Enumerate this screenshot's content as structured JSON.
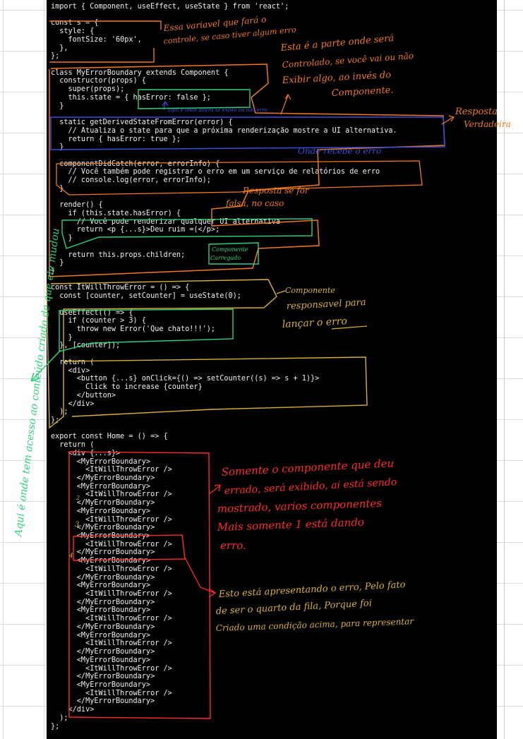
{
  "code_lines": [
    "import { Component, useEffect, useState } from 'react';",
    "",
    "const s = {",
    "  style: {",
    "    fontSize: '60px',",
    "  },",
    "};",
    "",
    "class MyErrorBoundary extends Component {",
    "  constructor(props) {",
    "    super(props);",
    "    this.state = { hasError: false };",
    "  }",
    "",
    "  static getDerivedStateFromError(error) {",
    "    // Atualiza o state para que a próxima renderização mostre a UI alternativa.",
    "    return { hasError: true };",
    "  }",
    "",
    "  componentDidCatch(error, errorInfo) {",
    "    // Você também pode registrar o erro em um serviço de relatórios de erro",
    "    // console.log(error, errorInfo);",
    "  }",
    "",
    "  render() {",
    "    if (this.state.hasError) {",
    "      // Você pode renderizar qualquer UI alternativa",
    "      return <p {...s}>Deu ruim =(</p>;",
    "    }",
    "",
    "    return this.props.children;",
    "  }",
    "}",
    "",
    "const ItWillThrowError = () => {",
    "  const [counter, setCounter] = useState(0);",
    "",
    "  useEffect(() => {",
    "    if (counter > 3) {",
    "      throw new Error('Que chato!!!');",
    "    }",
    "  }, [counter]);",
    "",
    "  return (",
    "    <div>",
    "      <button {...s} onClick={() => setCounter((s) => s + 1)}>",
    "        Click to increase {counter}",
    "      </button>",
    "    </div>",
    "  );",
    "};",
    "",
    "export const Home = () => {",
    "  return (",
    "    <div {...s}>",
    "      <MyErrorBoundary>",
    "        <ItWillThrowError />",
    "      </MyErrorBoundary>",
    "      <MyErrorBoundary>",
    "        <ItWillThrowError />",
    "      </MyErrorBoundary>",
    "      <MyErrorBoundary>",
    "        <ItWillThrowError />",
    "      </MyErrorBoundary>",
    "      <MyErrorBoundary>",
    "        <ItWillThrowError />",
    "      </MyErrorBoundary>",
    "      <MyErrorBoundary>",
    "        <ItWillThrowError />",
    "      </MyErrorBoundary>",
    "      <MyErrorBoundary>",
    "        <ItWillThrowError />",
    "      </MyErrorBoundary>",
    "      <MyErrorBoundary>",
    "        <ItWillThrowError />",
    "      </MyErrorBoundary>",
    "      <MyErrorBoundary>",
    "        <ItWillThrowError />",
    "      </MyErrorBoundary>",
    "      <MyErrorBoundary>",
    "        <ItWillThrowError />",
    "      </MyErrorBoundary>",
    "      <MyErrorBoundary>",
    "        <ItWillThrowError />",
    "      </MyErrorBoundary>",
    "    </div>",
    "  );",
    "};"
  ],
  "annotations": {
    "variable_note": [
      "Essa variavel que fará o",
      "controle, se caso tiver algum erro"
    ],
    "state_note": [
      "Esta é a parte onde será",
      "Controlado, se você vai ou não",
      "Exibir algo, ao invés do",
      "Componente."
    ],
    "state_mini": "aqui é onde altera se existe ou não erro",
    "true_response": [
      "Resposta",
      "Verdadeira"
    ],
    "error_received": "Onde recebe o erro",
    "false_response": [
      "Resposta se for",
      "falsa, no caso"
    ],
    "loaded_component": [
      "Componente",
      "Carregado"
    ],
    "thrower_note": [
      "Componente",
      "responsavel para",
      "lançar o erro"
    ],
    "side_note": "Aqui é onde tem acesso ao conteúdo criado de que ele mudou",
    "display_note": [
      "Somente o componente que deu",
      "errado, será exibido, ai está sendo",
      "mostrado, varios componentes",
      "Mais somente 1 está dando",
      "erro."
    ],
    "fourth_note": [
      "Esto está apresentando o erro, Pelo fato",
      "de ser o quarto da fila, Porque foi",
      "Criado uma condição acima, para representar"
    ],
    "row_numbers": [
      "2",
      "3",
      "4"
    ]
  },
  "colors": {
    "orange": "#f07a1e",
    "yellow": "#d9b13a",
    "green": "#2fd17a",
    "blue": "#3a4fd8",
    "red": "#ff2a2a",
    "code_text": "#f2f2f2",
    "panel": "#000000"
  }
}
